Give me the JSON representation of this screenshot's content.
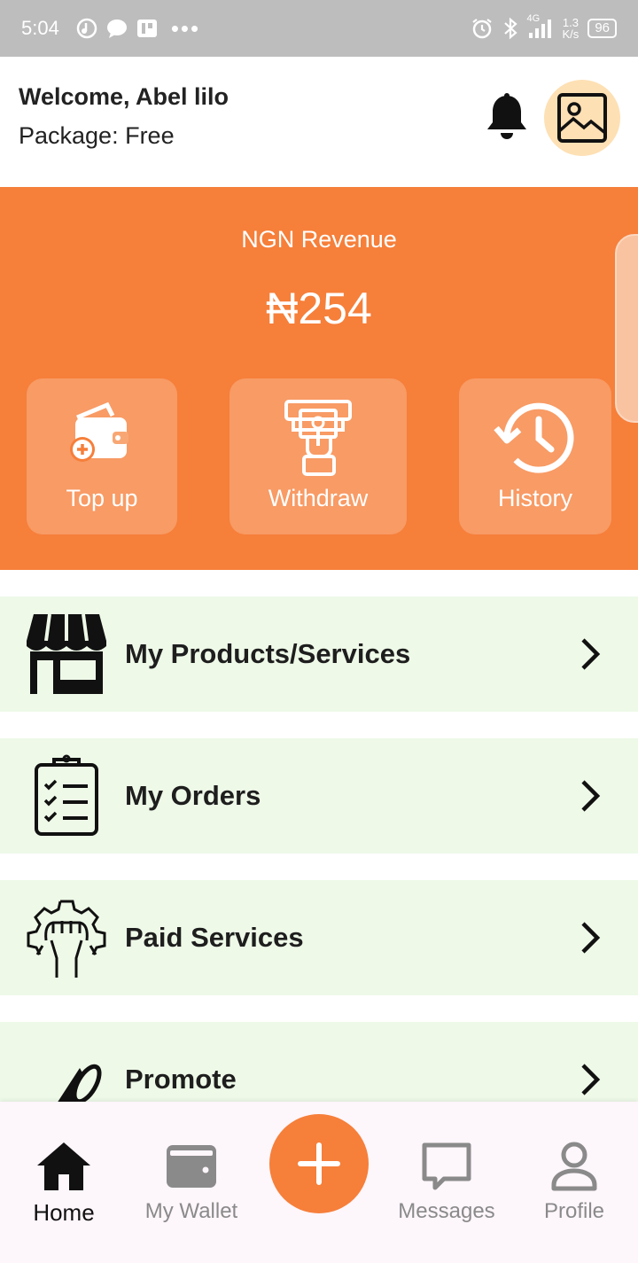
{
  "status_bar": {
    "time": "5:04",
    "dots": "•••",
    "network": "4G",
    "speed_value": "1.3",
    "speed_unit": "K/s",
    "battery": "96"
  },
  "header": {
    "welcome": "Welcome, Abel lilo",
    "package": "Package: Free"
  },
  "revenue": {
    "label": "NGN Revenue",
    "amount": "₦254"
  },
  "actions": [
    {
      "label": "Top up",
      "icon": "wallet-add-icon"
    },
    {
      "label": "Withdraw",
      "icon": "atm-withdraw-icon"
    },
    {
      "label": "History",
      "icon": "history-icon"
    }
  ],
  "menu": [
    {
      "label": "My Products/Services",
      "icon": "store-icon"
    },
    {
      "label": "My Orders",
      "icon": "clipboard-checklist-icon"
    },
    {
      "label": "Paid Services",
      "icon": "gear-hand-icon"
    },
    {
      "label": "Promote",
      "icon": "megaphone-icon"
    }
  ],
  "nav": {
    "home": "Home",
    "wallet": "My Wallet",
    "messages": "Messages",
    "profile": "Profile",
    "active": "home"
  },
  "colors": {
    "accent": "#f67f3a",
    "menu_bg": "#eef9e8",
    "avatar_bg": "#fde0b4"
  }
}
